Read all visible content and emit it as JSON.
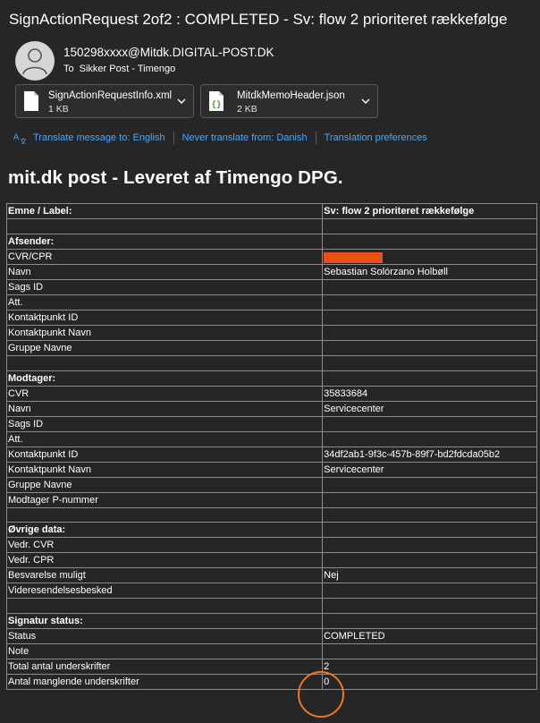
{
  "email": {
    "subject": "SignActionRequest 2of2 : COMPLETED - Sv: flow 2  prioriteret rækkefølge",
    "sender": "150298xxxx@Mitdk.DIGITAL-POST.DK",
    "to_label": "To",
    "to_value": "Sikker Post - Timengo"
  },
  "attachments": [
    {
      "name": "SignActionRequestInfo.xml",
      "size": "1 KB",
      "icon": "document-file-icon"
    },
    {
      "name": "MitdkMemoHeader.json",
      "size": "2 KB",
      "icon": "json-file-icon"
    }
  ],
  "translate_bar": {
    "translate": "Translate message to: English",
    "never": "Never translate from: Danish",
    "prefs": "Translation preferences"
  },
  "heading": "mit.dk post - Leveret af Timengo DPG.",
  "table": {
    "rows": [
      {
        "k": "Emne / Label:",
        "v": "Sv: flow 2 prioriteret rækkefølge",
        "bold": true
      },
      {
        "k": "",
        "v": ""
      },
      {
        "k": "Afsender:",
        "v": "",
        "bold": true
      },
      {
        "k": "CVR/CPR",
        "v": "",
        "redacted": true
      },
      {
        "k": "Navn",
        "v": "Sebastian Solórzano Holbøll"
      },
      {
        "k": "Sags ID",
        "v": ""
      },
      {
        "k": "Att.",
        "v": ""
      },
      {
        "k": "Kontaktpunkt ID",
        "v": ""
      },
      {
        "k": "Kontaktpunkt Navn",
        "v": ""
      },
      {
        "k": "Gruppe Navne",
        "v": ""
      },
      {
        "k": "",
        "v": ""
      },
      {
        "k": "Modtager:",
        "v": "",
        "bold": true
      },
      {
        "k": "CVR",
        "v": "35833684"
      },
      {
        "k": "Navn",
        "v": "Servicecenter"
      },
      {
        "k": "Sags ID",
        "v": ""
      },
      {
        "k": "Att.",
        "v": ""
      },
      {
        "k": "Kontaktpunkt ID",
        "v": "34df2ab1-9f3c-457b-89f7-bd2fdcda05b2"
      },
      {
        "k": "Kontaktpunkt Navn",
        "v": "Servicecenter"
      },
      {
        "k": "Gruppe Navne",
        "v": ""
      },
      {
        "k": "Modtager P-nummer",
        "v": ""
      },
      {
        "k": "",
        "v": ""
      },
      {
        "k": "Øvrige data:",
        "v": "",
        "bold": true
      },
      {
        "k": "Vedr. CVR",
        "v": ""
      },
      {
        "k": "Vedr. CPR",
        "v": ""
      },
      {
        "k": "Besvarelse muligt",
        "v": "Nej"
      },
      {
        "k": "Videresendelsesbesked",
        "v": ""
      },
      {
        "k": "",
        "v": ""
      },
      {
        "k": "Signatur status:",
        "v": "",
        "bold": true
      },
      {
        "k": "Status",
        "v": "COMPLETED"
      },
      {
        "k": "Note",
        "v": ""
      },
      {
        "k": "Total antal underskrifter",
        "v": "2"
      },
      {
        "k": "Antal manglende underskrifter",
        "v": "0"
      }
    ]
  },
  "colors": {
    "background": "#262626",
    "link": "#4aa8ff",
    "redaction": "#ea4f13",
    "highlight_circle": "#f2771a"
  }
}
